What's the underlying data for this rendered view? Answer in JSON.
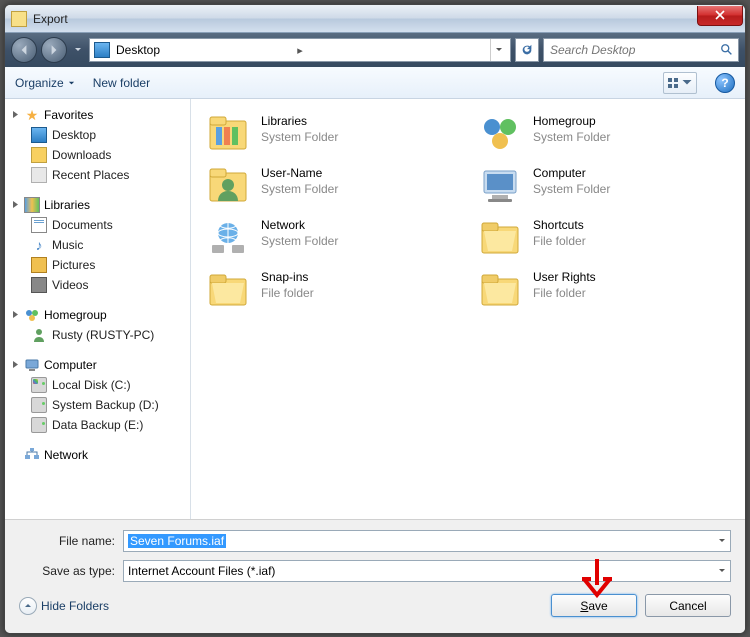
{
  "window": {
    "title": "Export"
  },
  "nav": {
    "location": "Desktop",
    "search_placeholder": "Search Desktop"
  },
  "toolbar": {
    "organize": "Organize",
    "new_folder": "New folder"
  },
  "sidebar": {
    "favorites": {
      "label": "Favorites",
      "items": [
        "Desktop",
        "Downloads",
        "Recent Places"
      ]
    },
    "libraries": {
      "label": "Libraries",
      "items": [
        "Documents",
        "Music",
        "Pictures",
        "Videos"
      ]
    },
    "homegroup": {
      "label": "Homegroup",
      "items": [
        "Rusty (RUSTY-PC)"
      ]
    },
    "computer": {
      "label": "Computer",
      "items": [
        "Local Disk (C:)",
        "System Backup (D:)",
        "Data Backup (E:)"
      ]
    },
    "network": {
      "label": "Network"
    }
  },
  "items": [
    {
      "title": "Libraries",
      "sub": "System Folder",
      "icon": "libraries"
    },
    {
      "title": "Homegroup",
      "sub": "System Folder",
      "icon": "homegroup"
    },
    {
      "title": "User-Name",
      "sub": "System Folder",
      "icon": "user"
    },
    {
      "title": "Computer",
      "sub": "System Folder",
      "icon": "computer"
    },
    {
      "title": "Network",
      "sub": "System Folder",
      "icon": "network"
    },
    {
      "title": "Shortcuts",
      "sub": "File folder",
      "icon": "folder"
    },
    {
      "title": "Snap-ins",
      "sub": "File folder",
      "icon": "folder"
    },
    {
      "title": "User Rights",
      "sub": "File folder",
      "icon": "folder"
    }
  ],
  "bottom": {
    "filename_label": "File name:",
    "filename_value": "Seven Forums.iaf",
    "type_label": "Save as type:",
    "type_value": "Internet Account Files (*.iaf)",
    "hide_folders": "Hide Folders",
    "save": "Save",
    "cancel": "Cancel"
  }
}
